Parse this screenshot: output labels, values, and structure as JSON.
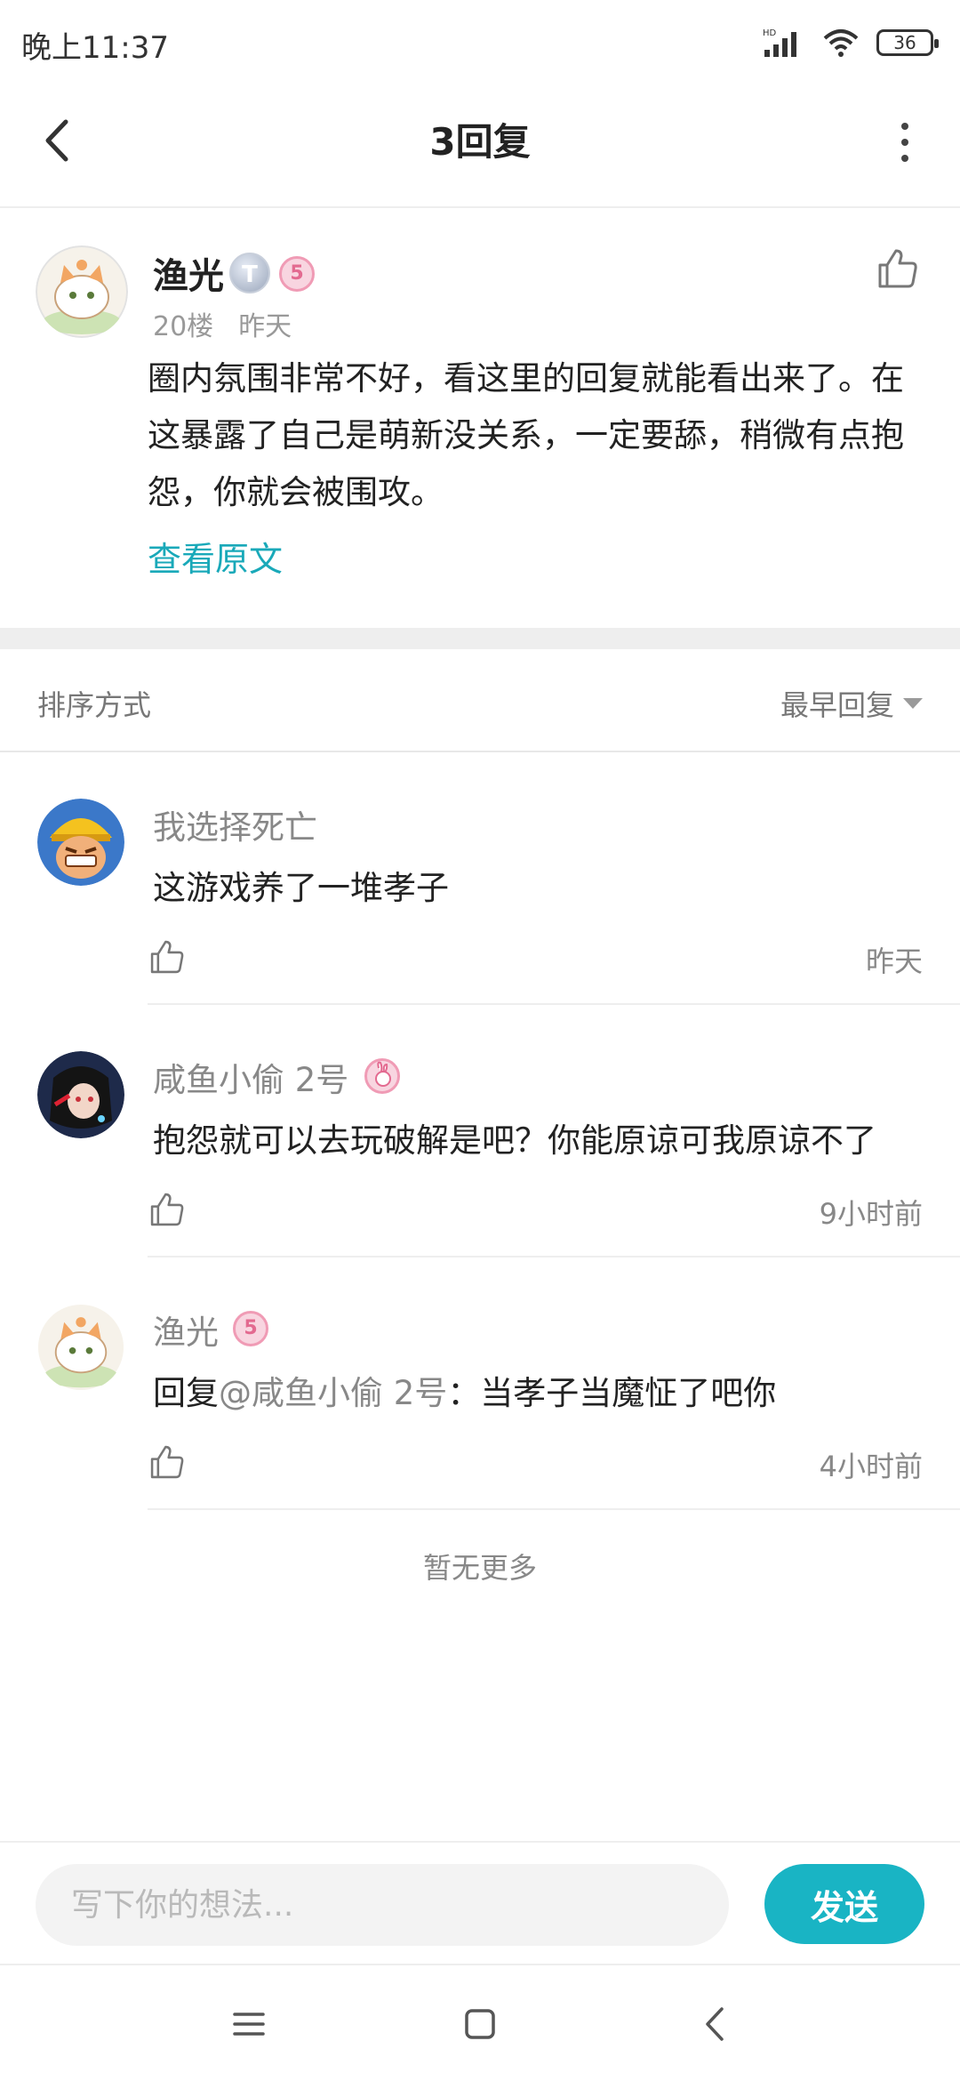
{
  "status_bar": {
    "time": "晚上11:37",
    "battery": "36"
  },
  "header": {
    "title": "3回复"
  },
  "post": {
    "author": "渔光",
    "title_badge": "T",
    "level_badge": "5",
    "floor": "20楼",
    "time": "昨天",
    "text": "圈内氛围非常不好，看这里的回复就能看出来了。在这暴露了自己是萌新没关系，一定要舔，稍微有点抱怨，你就会被围攻。",
    "view_original": "查看原文"
  },
  "sort": {
    "label": "排序方式",
    "selected": "最早回复"
  },
  "replies": [
    {
      "author": "我选择死亡",
      "text": "这游戏养了一堆孝子",
      "time": "昨天"
    },
    {
      "author": "咸鱼小偷 2号",
      "text": "抱怨就可以去玩破解是吧？你能原谅可我原谅不了",
      "time": "9小时前"
    },
    {
      "author": "渔光",
      "level_badge": "5",
      "reply_prefix": "回复",
      "mention": "@咸鱼小偷 2号",
      "text": "：当孝子当魔怔了吧你",
      "time": "4小时前"
    }
  ],
  "footer": {
    "no_more": "暂无更多"
  },
  "input": {
    "placeholder": "写下你的想法...",
    "send_label": "发送"
  },
  "colors": {
    "accent": "#19b4c4",
    "link": "#19a9b9"
  }
}
